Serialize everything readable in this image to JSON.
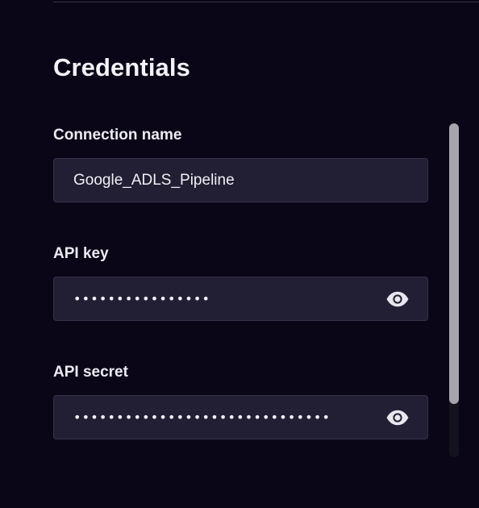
{
  "credentials": {
    "title": "Credentials",
    "fields": [
      {
        "label": "Connection name",
        "value": "Google_ADLS_Pipeline",
        "type": "text"
      },
      {
        "label": "API key",
        "value": "••••••••••••••••",
        "type": "password",
        "reveal_icon": "eye-icon"
      },
      {
        "label": "API secret",
        "value": "••••••••••••••••••••••••••••••",
        "type": "password",
        "reveal_icon": "eye-icon"
      }
    ]
  },
  "scrollbar": {
    "position_fraction": 0.0,
    "visible_fraction": 0.84
  },
  "colors": {
    "background": "#0a0617",
    "field_background": "#221e33",
    "field_border": "#35314a",
    "text": "#f1f0f5",
    "scrollbar_thumb": "#a7a4ae"
  }
}
